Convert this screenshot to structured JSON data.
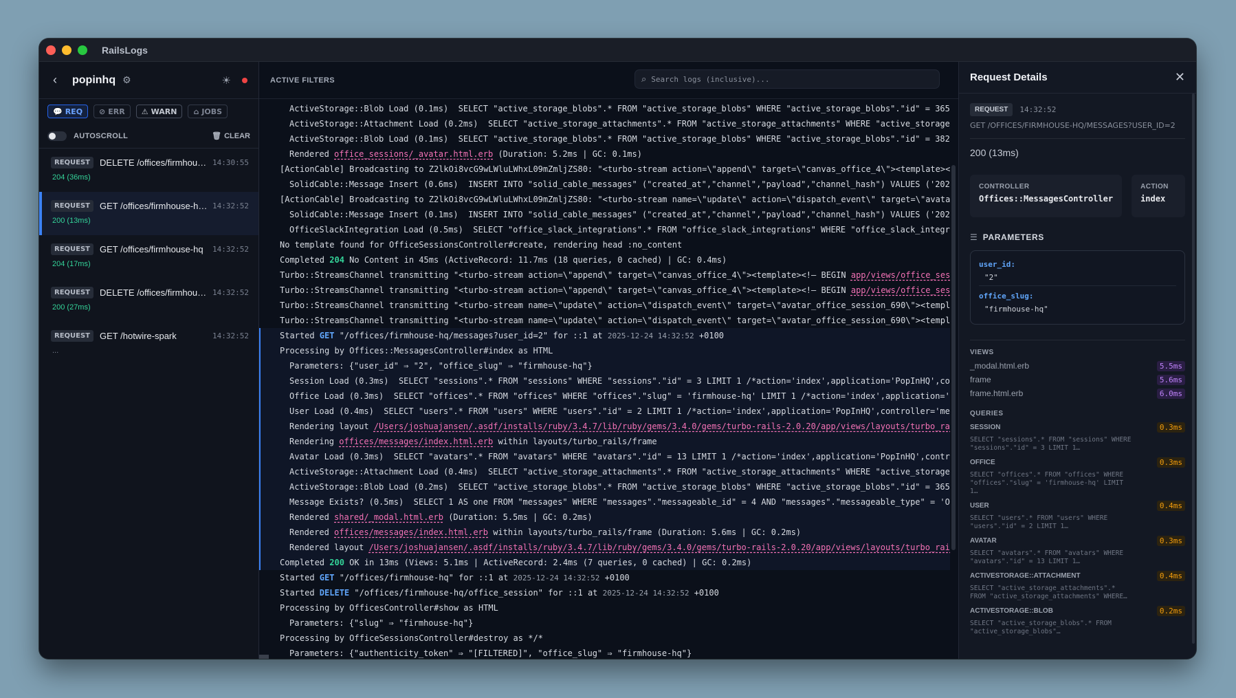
{
  "app": {
    "title": "RailsLogs"
  },
  "sidebar": {
    "project": "popinhq",
    "filters": [
      {
        "label": "REQ",
        "icon": "💬"
      },
      {
        "label": "ERR",
        "icon": "⊘"
      },
      {
        "label": "WARN",
        "icon": "⚠"
      },
      {
        "label": "JOBS",
        "icon": "⌂"
      }
    ],
    "autoscroll_label": "AUTOSCROLL",
    "clear_label": "CLEAR",
    "requests": [
      {
        "badge": "REQUEST",
        "path": "DELETE /offices/firmhouse-hq/office_session",
        "time": "14:30:55",
        "status": "204 (36ms)"
      },
      {
        "badge": "REQUEST",
        "path": "GET /offices/firmhouse-hq/messages?user_id=2",
        "time": "14:32:52",
        "status": "200 (13ms)"
      },
      {
        "badge": "REQUEST",
        "path": "GET /offices/firmhouse-hq",
        "time": "14:32:52",
        "status": "204 (17ms)"
      },
      {
        "badge": "REQUEST",
        "path": "DELETE /offices/firmhouse-hq/office_session",
        "time": "14:32:52",
        "status": "200 (27ms)"
      },
      {
        "badge": "REQUEST",
        "path": "GET /hotwire-spark",
        "time": "14:32:52",
        "status": "..."
      }
    ]
  },
  "main": {
    "active_filters_label": "ACTIVE FILTERS",
    "search_placeholder": "Search logs (inclusive)...",
    "log": [
      {
        "ind": true,
        "pre": "ActiveStorage::Blob Load (0.1ms)  SELECT \"active_storage_blobs\".* FROM \"active_storage_blobs\" WHERE \"active_storage_blobs\".\"id\" = 365"
      },
      {
        "ind": true,
        "pre": "ActiveStorage::Attachment Load (0.2ms)  SELECT \"active_storage_attachments\".* FROM \"active_storage_attachments\" WHERE \"active_storage_"
      },
      {
        "ind": true,
        "pre": "ActiveStorage::Blob Load (0.1ms)  SELECT \"active_storage_blobs\".* FROM \"active_storage_blobs\" WHERE \"active_storage_blobs\".\"id\" = 382"
      },
      {
        "ind": true,
        "pre": "Rendered ",
        "link": "office_sessions/_avatar.html.erb",
        "post": " (Duration: 5.2ms | GC: 0.1ms)"
      },
      {
        "pre": "[ActionCable] Broadcasting to Z2lkOi8vcG9wLWluLWhxL09mZmljZS80: \"<turbo-stream action=\\\"append\\\" target=\\\"canvas_office_4\\\"><template><!—"
      },
      {
        "ind": true,
        "pre": "SolidCable::Message Insert (0.6ms)  INSERT INTO \"solid_cable_messages\" (\"created_at\",\"channel\",\"payload\",\"channel_hash\") VALUES ('2025"
      },
      {
        "pre": "[ActionCable] Broadcasting to Z2lkOi8vcG9wLWluLWhxL09mZmljZS80: \"<turbo-stream name=\\\"update\\\" action=\\\"dispatch_event\\\" target=\\\"avatar"
      },
      {
        "ind": true,
        "pre": "SolidCable::Message Insert (0.1ms)  INSERT INTO \"solid_cable_messages\" (\"created_at\",\"channel\",\"payload\",\"channel_hash\") VALUES ('2025"
      },
      {
        "ind": true,
        "pre": "OfficeSlackIntegration Load (0.5ms)  SELECT \"office_slack_integrations\".* FROM \"office_slack_integrations\" WHERE \"office_slack_integra"
      },
      {
        "pre": "No template found for OfficeSessionsController#create, rendering head :no_content"
      },
      {
        "pre": "Completed ",
        "status": "204",
        "post": " No Content in 45ms (ActiveRecord: 11.7ms (18 queries, 0 cached) | GC: 0.4ms)"
      },
      {
        "pre": "Turbo::StreamsChannel transmitting \"<turbo-stream action=\\\"append\\\" target=\\\"canvas_office_4\\\"><template><!— BEGIN ",
        "link": "app/views/office_ses"
      },
      {
        "pre": "Turbo::StreamsChannel transmitting \"<turbo-stream action=\\\"append\\\" target=\\\"canvas_office_4\\\"><template><!— BEGIN ",
        "link": "app/views/office_ses"
      },
      {
        "pre": "Turbo::StreamsChannel transmitting \"<turbo-stream name=\\\"update\\\" action=\\\"dispatch_event\\\" target=\\\"avatar_office_session_690\\\"><templa"
      },
      {
        "pre": "Turbo::StreamsChannel transmitting \"<turbo-stream name=\\\"update\\\" action=\\\"dispatch_event\\\" target=\\\"avatar_office_session_690\\\"><templa"
      },
      {
        "hl": true,
        "pre": "Started ",
        "method": "GET",
        "post": " \"/offices/firmhouse-hq/messages?user_id=2\" for ::1 at ",
        "ts": "2025-12-24 14:32:52",
        "tail": " +0100"
      },
      {
        "hl": true,
        "pre": "Processing by Offices::MessagesController#index as HTML"
      },
      {
        "hl": true,
        "ind": true,
        "pre": "Parameters: {\"user_id\" ⇒ \"2\", \"office_slug\" ⇒ \"firmhouse-hq\"}"
      },
      {
        "hl": true,
        "ind": true,
        "pre": "Session Load (0.3ms)  SELECT \"sessions\".* FROM \"sessions\" WHERE \"sessions\".\"id\" = 3 LIMIT 1 /*action='index',application='PopInHQ',co"
      },
      {
        "hl": true,
        "ind": true,
        "pre": "Office Load (0.3ms)  SELECT \"offices\".* FROM \"offices\" WHERE \"offices\".\"slug\" = 'firmhouse-hq' LIMIT 1 /*action='index',application='P"
      },
      {
        "hl": true,
        "ind": true,
        "pre": "User Load (0.4ms)  SELECT \"users\".* FROM \"users\" WHERE \"users\".\"id\" = 2 LIMIT 1 /*action='index',application='PopInHQ',controller='mes"
      },
      {
        "hl": true,
        "ind": true,
        "pre": "Rendering layout ",
        "link": "/Users/joshuajansen/.asdf/installs/ruby/3.4.7/lib/ruby/gems/3.4.0/gems/turbo-rails-2.0.20/app/views/layouts/turbo_rai"
      },
      {
        "hl": true,
        "ind": true,
        "pre": "Rendering ",
        "link": "offices/messages/index.html.erb",
        "post": " within layouts/turbo_rails/frame"
      },
      {
        "hl": true,
        "ind": true,
        "pre": "Avatar Load (0.3ms)  SELECT \"avatars\".* FROM \"avatars\" WHERE \"avatars\".\"id\" = 13 LIMIT 1 /*action='index',application='PopInHQ',contro"
      },
      {
        "hl": true,
        "ind": true,
        "pre": "ActiveStorage::Attachment Load (0.4ms)  SELECT \"active_storage_attachments\".* FROM \"active_storage_attachments\" WHERE \"active_storage_"
      },
      {
        "hl": true,
        "ind": true,
        "pre": "ActiveStorage::Blob Load (0.2ms)  SELECT \"active_storage_blobs\".* FROM \"active_storage_blobs\" WHERE \"active_storage_blobs\".\"id\" = 365"
      },
      {
        "hl": true,
        "ind": true,
        "pre": "Message Exists? (0.5ms)  SELECT 1 AS one FROM \"messages\" WHERE \"messages\".\"messageable_id\" = 4 AND \"messages\".\"messageable_type\" = 'Of"
      },
      {
        "hl": true,
        "ind": true,
        "pre": "Rendered ",
        "link": "shared/_modal.html.erb",
        "post": " (Duration: 5.5ms | GC: 0.2ms)"
      },
      {
        "hl": true,
        "ind": true,
        "pre": "Rendered ",
        "link": "offices/messages/index.html.erb",
        "post": " within layouts/turbo_rails/frame (Duration: 5.6ms | GC: 0.2ms)"
      },
      {
        "hl": true,
        "ind": true,
        "pre": "Rendered layout ",
        "link": "/Users/joshuajansen/.asdf/installs/ruby/3.4.7/lib/ruby/gems/3.4.0/gems/turbo-rails-2.0.20/app/views/layouts/turbo_rail"
      },
      {
        "hl": true,
        "pre": "Completed ",
        "status": "200",
        "post": " OK in 13ms (Views: 5.1ms | ActiveRecord: 2.4ms (7 queries, 0 cached) | GC: 0.2ms)"
      },
      {
        "pre": "Started ",
        "method": "GET",
        "post": " \"/offices/firmhouse-hq\" for ::1 at ",
        "ts": "2025-12-24 14:32:52",
        "tail": " +0100"
      },
      {
        "pre": "Started ",
        "method": "DELETE",
        "post": " \"/offices/firmhouse-hq/office_session\" for ::1 at ",
        "ts": "2025-12-24 14:32:52",
        "tail": " +0100"
      },
      {
        "pre": "Processing by OfficesController#show as HTML"
      },
      {
        "ind": true,
        "pre": "Parameters: {\"slug\" ⇒ \"firmhouse-hq\"}"
      },
      {
        "pre": "Processing by OfficeSessionsController#destroy as */*"
      },
      {
        "ind": true,
        "pre": "Parameters: {\"authenticity_token\" ⇒ \"[FILTERED]\", \"office_slug\" ⇒ \"firmhouse-hq\"}"
      }
    ]
  },
  "details": {
    "title": "Request Details",
    "badge": "REQUEST",
    "time": "14:32:52",
    "path": "GET /OFFICES/FIRMHOUSE-HQ/MESSAGES?USER_ID=2",
    "status": "200 (13ms)",
    "controller_label": "CONTROLLER",
    "controller_value": "Offices::MessagesController",
    "action_label": "ACTION",
    "action_value": "index",
    "params_title": "PARAMETERS",
    "params": [
      {
        "key": "user_id:",
        "value": "\"2\""
      },
      {
        "key": "office_slug:",
        "value": "\"firmhouse-hq\""
      }
    ],
    "views_title": "VIEWS",
    "views": [
      {
        "name": "_modal.html.erb",
        "ms": "5.5ms"
      },
      {
        "name": "frame",
        "ms": "5.6ms"
      },
      {
        "name": "frame.html.erb",
        "ms": "6.0ms"
      }
    ],
    "queries_title": "QUERIES",
    "queries": [
      {
        "name": "SESSION",
        "ms": "0.3ms",
        "sql": "SELECT \"sessions\".* FROM \"sessions\" WHERE \"sessions\".\"id\" = 3 LIMIT 1…"
      },
      {
        "name": "OFFICE",
        "ms": "0.3ms",
        "sql": "SELECT \"offices\".* FROM \"offices\" WHERE \"offices\".\"slug\" = 'firmhouse-hq' LIMIT 1…"
      },
      {
        "name": "USER",
        "ms": "0.4ms",
        "sql": "SELECT \"users\".* FROM \"users\" WHERE \"users\".\"id\" = 2 LIMIT 1…"
      },
      {
        "name": "AVATAR",
        "ms": "0.3ms",
        "sql": "SELECT \"avatars\".* FROM \"avatars\" WHERE \"avatars\".\"id\" = 13 LIMIT 1…"
      },
      {
        "name": "ACTIVESTORAGE::ATTACHMENT",
        "ms": "0.4ms",
        "sql": "SELECT \"active_storage_attachments\".* FROM \"active_storage_attachments\" WHERE…"
      },
      {
        "name": "ACTIVESTORAGE::BLOB",
        "ms": "0.2ms",
        "sql": "SELECT \"active_storage_blobs\".* FROM \"active_storage_blobs\"…"
      }
    ]
  }
}
